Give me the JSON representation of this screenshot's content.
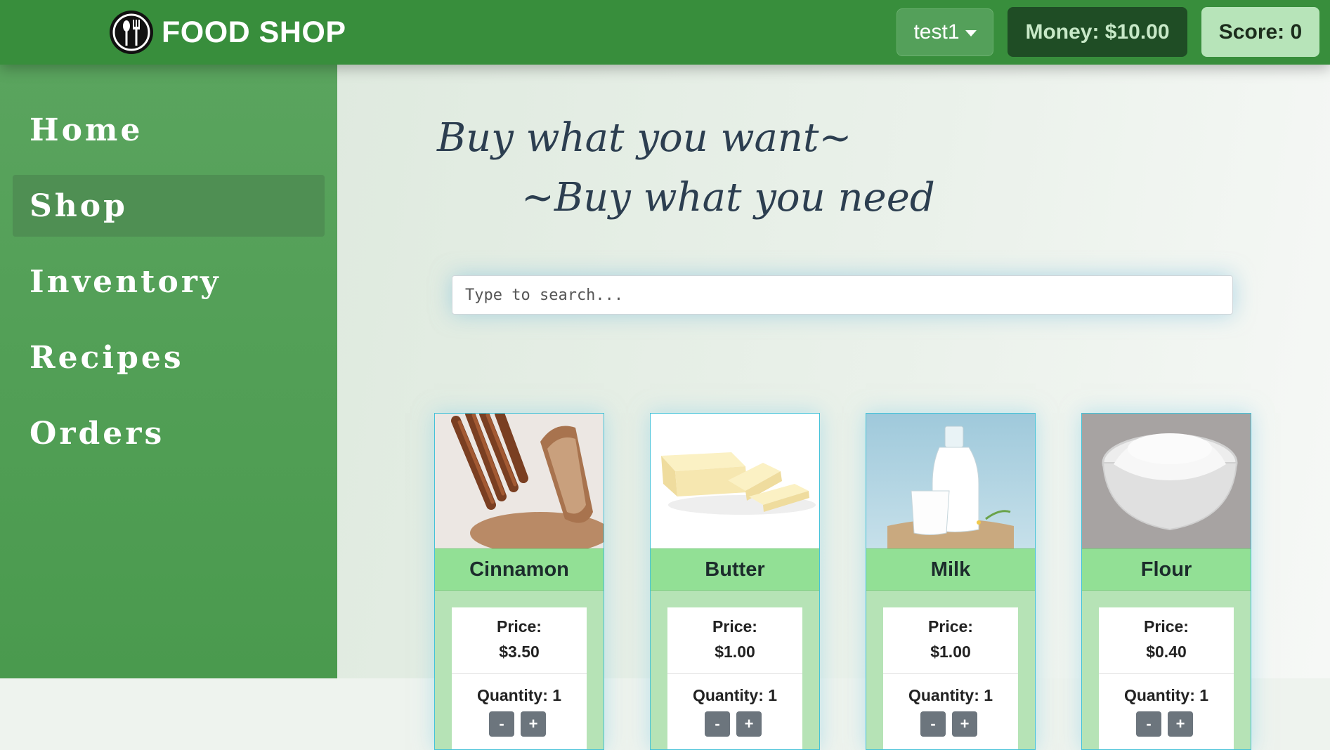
{
  "navbar": {
    "brand": "FOOD SHOP",
    "user": "test1",
    "money": "Money: $10.00",
    "score": "Score: 0"
  },
  "sidebar": {
    "items": [
      {
        "label": "Home",
        "active": false
      },
      {
        "label": "Shop",
        "active": true
      },
      {
        "label": "Inventory",
        "active": false
      },
      {
        "label": "Recipes",
        "active": false
      },
      {
        "label": "Orders",
        "active": false
      }
    ]
  },
  "main": {
    "tagline1": "Buy what you want~",
    "tagline2": "~Buy what you need",
    "search_placeholder": "Type to search...",
    "price_label": "Price:",
    "cards": [
      {
        "name": "Cinnamon",
        "price": "$3.50",
        "quantity": "Quantity: 1",
        "minus": "-",
        "plus": "+"
      },
      {
        "name": "Butter",
        "price": "$1.00",
        "quantity": "Quantity: 1",
        "minus": "-",
        "plus": "+"
      },
      {
        "name": "Milk",
        "price": "$1.00",
        "quantity": "Quantity: 1",
        "minus": "-",
        "plus": "+"
      },
      {
        "name": "Flour",
        "price": "$0.40",
        "quantity": "Quantity: 1",
        "minus": "-",
        "plus": "+"
      }
    ]
  },
  "colors": {
    "navbar": "#388e3c",
    "sidebar": "#4f9f53",
    "card_title": "#92e095",
    "card_body": "#b6e3b6"
  }
}
